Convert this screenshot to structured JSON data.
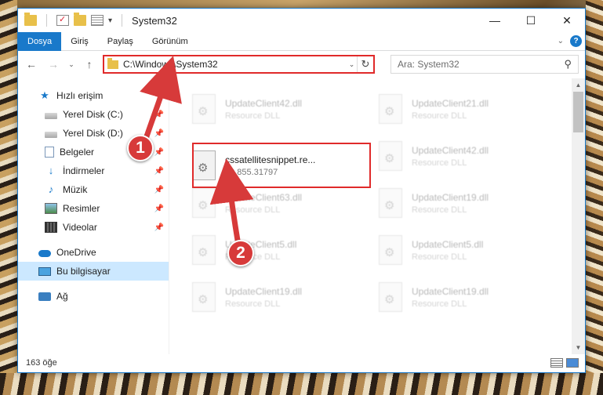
{
  "window": {
    "title": "System32",
    "controls": {
      "minimize": "—",
      "maximize": "☐",
      "close": "✕"
    }
  },
  "ribbon": {
    "tabs": [
      "Dosya",
      "Giriş",
      "Paylaş",
      "Görünüm"
    ],
    "help": "?"
  },
  "address_bar": {
    "path": "C:\\Windows\\System32",
    "back": "←",
    "forward": "→",
    "recent": "⌄",
    "up": "↑",
    "refresh": "↻"
  },
  "search": {
    "placeholder": "Ara: System32",
    "icon": "search-icon"
  },
  "nav_pane": {
    "quick_access": "Hızlı erişim",
    "items": [
      {
        "label": "Yerel Disk (C:)",
        "icon": "drive-icon",
        "pinned": true
      },
      {
        "label": "Yerel Disk (D:)",
        "icon": "drive-icon",
        "pinned": true
      },
      {
        "label": "Belgeler",
        "icon": "documents-icon",
        "pinned": true
      },
      {
        "label": "İndirmeler",
        "icon": "downloads-icon",
        "pinned": true
      },
      {
        "label": "Müzik",
        "icon": "music-icon",
        "pinned": true
      },
      {
        "label": "Resimler",
        "icon": "pictures-icon",
        "pinned": true
      },
      {
        "label": "Videolar",
        "icon": "videos-icon",
        "pinned": true
      }
    ],
    "onedrive": "OneDrive",
    "this_pc": "Bu bilgisayar",
    "network": "Ağ"
  },
  "files": {
    "highlighted": {
      "name": "cssatellitesnippet.re...",
      "sub": "10.855.31797"
    },
    "ghost_left": [
      {
        "name": "UpdateClient42.dll",
        "sub": "Resource DLL"
      },
      {
        "name": "UpdateClient63.dll",
        "sub": "Resource DLL"
      },
      {
        "name": "UpdateClient5.dll",
        "sub": "Resource DLL"
      },
      {
        "name": "UpdateClient19.dll",
        "sub": "Resource DLL"
      }
    ],
    "ghost_right": [
      {
        "name": "UpdateClient21.dll",
        "sub": "Resource DLL"
      },
      {
        "name": "UpdateClient42.dll",
        "sub": "Resource DLL"
      },
      {
        "name": "UpdateClient19.dll",
        "sub": "Resource DLL"
      },
      {
        "name": "UpdateClient5.dll",
        "sub": "Resource DLL"
      },
      {
        "name": "UpdateClient19.dll",
        "sub": "Resource DLL"
      }
    ]
  },
  "status": {
    "count": "163 öğe"
  },
  "annotations": {
    "step1": "1",
    "step2": "2",
    "color": "#d73a3a"
  }
}
